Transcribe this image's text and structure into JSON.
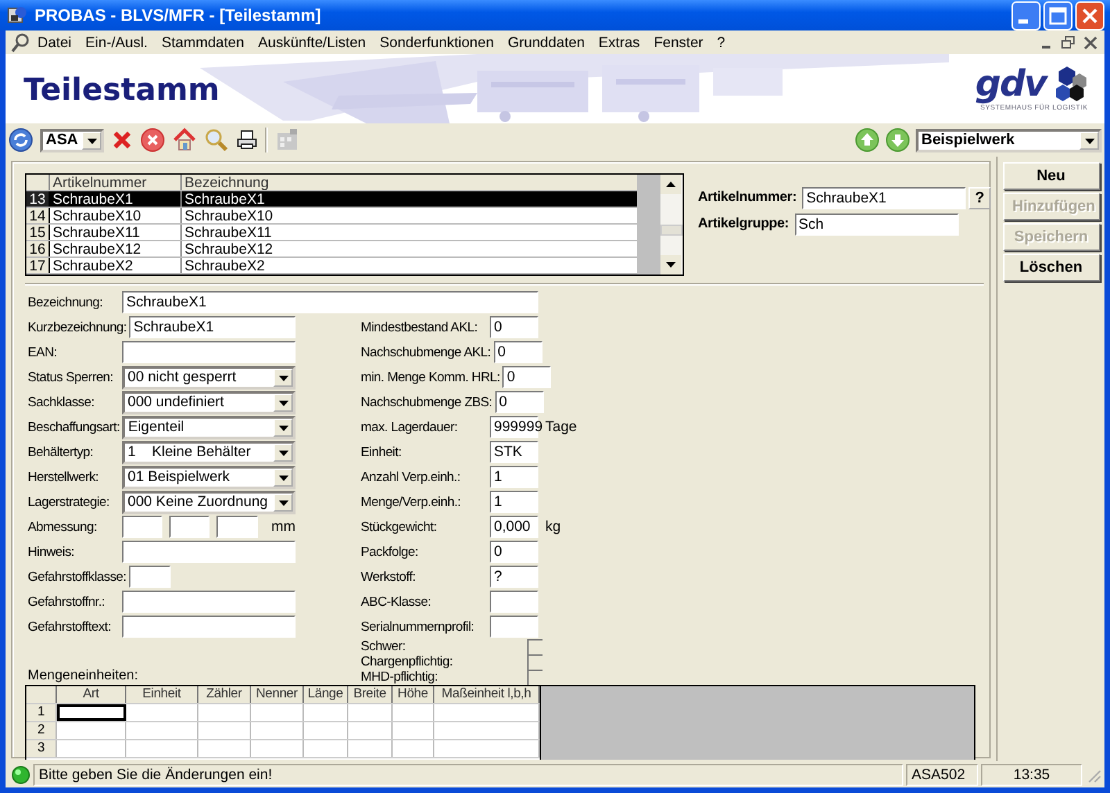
{
  "window": {
    "title": "PROBAS - BLVS/MFR - [Teilestamm]"
  },
  "menu": [
    "Datei",
    "Ein-/Ausl.",
    "Stammdaten",
    "Auskünfte/Listen",
    "Sonderfunktionen",
    "Grunddaten",
    "Extras",
    "Fenster",
    "?"
  ],
  "banner": {
    "title": "Teilestamm",
    "logo": "gdv",
    "tagline": "SYSTEMHAUS FÜR LOGISTIK"
  },
  "toolbar": {
    "client": "ASA",
    "plant": "Beispielwerk"
  },
  "article_list": {
    "columns": [
      "Artikelnummer",
      "Bezeichnung"
    ],
    "rows": [
      {
        "index": "13",
        "artikelnummer": "SchraubeX1",
        "bezeichnung": "SchraubeX1",
        "selected": true
      },
      {
        "index": "14",
        "artikelnummer": "SchraubeX10",
        "bezeichnung": "SchraubeX10",
        "selected": false
      },
      {
        "index": "15",
        "artikelnummer": "SchraubeX11",
        "bezeichnung": "SchraubeX11",
        "selected": false
      },
      {
        "index": "16",
        "artikelnummer": "SchraubeX12",
        "bezeichnung": "SchraubeX12",
        "selected": false
      },
      {
        "index": "17",
        "artikelnummer": "SchraubeX2",
        "bezeichnung": "SchraubeX2",
        "selected": false
      }
    ]
  },
  "lookup": {
    "fields": [
      {
        "label": "Artikelnummer:",
        "value": "SchraubeX1"
      },
      {
        "label": "Artikelgruppe:",
        "value": "Sch"
      }
    ],
    "help": "?"
  },
  "actions": [
    {
      "label": "Neu",
      "disabled": false
    },
    {
      "label": "Hinzufügen",
      "disabled": true
    },
    {
      "label": "Speichern",
      "disabled": true
    },
    {
      "label": "Löschen",
      "disabled": false
    }
  ],
  "form": {
    "bezeichnung": {
      "label": "Bezeichnung:",
      "value": "SchraubeX1"
    },
    "left": [
      {
        "kind": "text",
        "label": "Kurzbezeichnung:",
        "value": "SchraubeX1"
      },
      {
        "kind": "text",
        "label": "EAN:"
      },
      {
        "kind": "select",
        "label": "Status Sperren:",
        "value": "00 nicht gesperrt"
      },
      {
        "kind": "select",
        "label": "Sachklasse:",
        "value": "000 undefiniert"
      },
      {
        "kind": "select",
        "label": "Beschaffungsart:",
        "value": "Eigenteil"
      },
      {
        "kind": "select",
        "label": "Behältertyp:",
        "value": "1    Kleine Behälter"
      },
      {
        "kind": "select",
        "label": "Herstellwerk:",
        "value": "01 Beispielwerk"
      },
      {
        "kind": "select",
        "label": "Lagerstrategie:",
        "value": "000 Keine Zuordnung"
      },
      {
        "kind": "dimensions",
        "label": "Abmessung:",
        "unit": "mm"
      },
      {
        "kind": "text",
        "label": "Hinweis:"
      },
      {
        "kind": "short",
        "label": "Gefahrstoffklasse:"
      },
      {
        "kind": "text",
        "label": "Gefahrstoffnr.:"
      },
      {
        "kind": "text",
        "label": "Gefahrstofftext:"
      }
    ],
    "right": [
      {
        "kind": "number",
        "label": "Mindestbestand AKL:",
        "value": "0"
      },
      {
        "kind": "number",
        "label": "Nachschubmenge AKL:",
        "value": "0"
      },
      {
        "kind": "number",
        "label": "min. Menge Komm. HRL:",
        "value": "0"
      },
      {
        "kind": "number",
        "label": "Nachschubmenge ZBS:",
        "value": "0"
      },
      {
        "kind": "number",
        "label": "max. Lagerdauer:",
        "value": "999999",
        "unit": "Tage"
      },
      {
        "kind": "number",
        "label": "Einheit:",
        "value": "STK"
      },
      {
        "kind": "number",
        "label": "Anzahl Verp.einh.:",
        "value": "1"
      },
      {
        "kind": "number",
        "label": "Menge/Verp.einh.:",
        "value": "1"
      },
      {
        "kind": "number",
        "label": "Stückgewicht:",
        "value": "0,000",
        "unit": "kg"
      },
      {
        "kind": "number",
        "label": "Packfolge:",
        "value": "0"
      },
      {
        "kind": "number",
        "label": "Werkstoff:",
        "value": "?"
      },
      {
        "kind": "number",
        "label": "ABC-Klasse:"
      },
      {
        "kind": "number",
        "label": "Serialnummernprofil:"
      },
      {
        "kind": "checkbox",
        "label": "Schwer:",
        "checked": false
      },
      {
        "kind": "checkbox",
        "label": "Chargenpflichtig:",
        "checked": false
      },
      {
        "kind": "checkbox",
        "label": "MHD-pflichtig:",
        "checked": false
      }
    ]
  },
  "units_table": {
    "title": "Mengeneinheiten:",
    "columns": [
      "Art",
      "Einheit",
      "Zähler",
      "Nenner",
      "Länge",
      "Breite",
      "Höhe",
      "Maßeinheit l,b,h"
    ],
    "rows": [
      {
        "label": "1",
        "focused": true
      },
      {
        "label": "2",
        "focused": false
      },
      {
        "label": "3",
        "focused": false
      }
    ]
  },
  "status_bar": {
    "message": "Bitte geben Sie die Änderungen ein!",
    "user": "ASA502",
    "time": "13:35"
  }
}
